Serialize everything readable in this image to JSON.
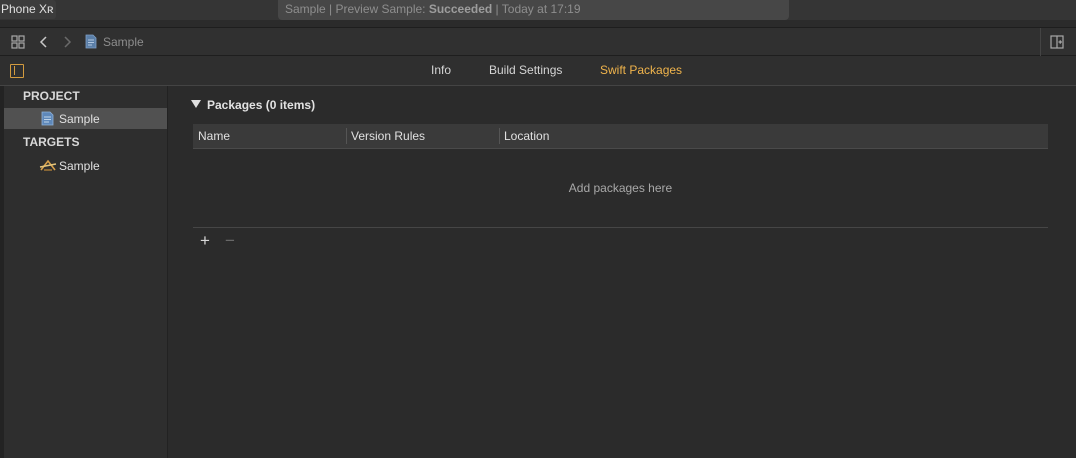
{
  "toolbar": {
    "device": "Phone Xʀ",
    "status_prefix": "Sample | Preview Sample: ",
    "status_result": "Succeeded",
    "status_suffix": " | Today at 17:19"
  },
  "jumpbar": {
    "title": "Sample"
  },
  "tabs": [
    {
      "label": "Info",
      "active": false
    },
    {
      "label": "Build Settings",
      "active": false
    },
    {
      "label": "Swift Packages",
      "active": true
    }
  ],
  "sidebar": {
    "project_header": "PROJECT",
    "project_item": "Sample",
    "targets_header": "TARGETS",
    "target_item": "Sample"
  },
  "packages": {
    "title": "Packages (0 items)",
    "columns": [
      "Name",
      "Version Rules",
      "Location"
    ],
    "empty_message": "Add packages here",
    "add_label": "+",
    "remove_label": "−"
  },
  "colors": {
    "accent": "#f0b44c",
    "background": "#2b2b2b"
  }
}
